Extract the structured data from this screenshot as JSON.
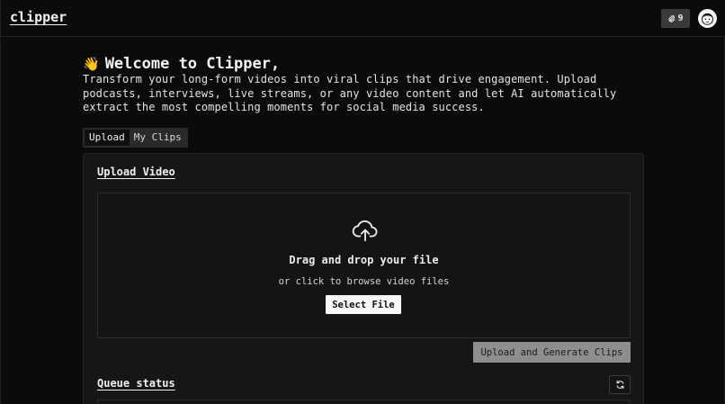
{
  "header": {
    "brand": "clipper",
    "credits": "9"
  },
  "welcome": {
    "emoji": "👋",
    "title": "Welcome to Clipper,",
    "description": "Transform your long-form videos into viral clips that drive engagement. Upload podcasts, interviews, live streams, or any video content and let AI automatically extract the most compelling moments for social media success."
  },
  "tabs": [
    {
      "label": "Upload",
      "active": true
    },
    {
      "label": "My Clips",
      "active": false
    }
  ],
  "upload": {
    "title": "Upload Video",
    "drop_title": "Drag and drop your file",
    "drop_subtitle": "or click to browse video files",
    "select_label": "Select File",
    "submit_label": "Upload and Generate Clips"
  },
  "queue": {
    "title": "Queue status"
  },
  "colors": {
    "background": "#0b0b0b",
    "card": "#161616",
    "button_light": "#f6f6f6",
    "button_disabled": "#8e8e8e"
  }
}
